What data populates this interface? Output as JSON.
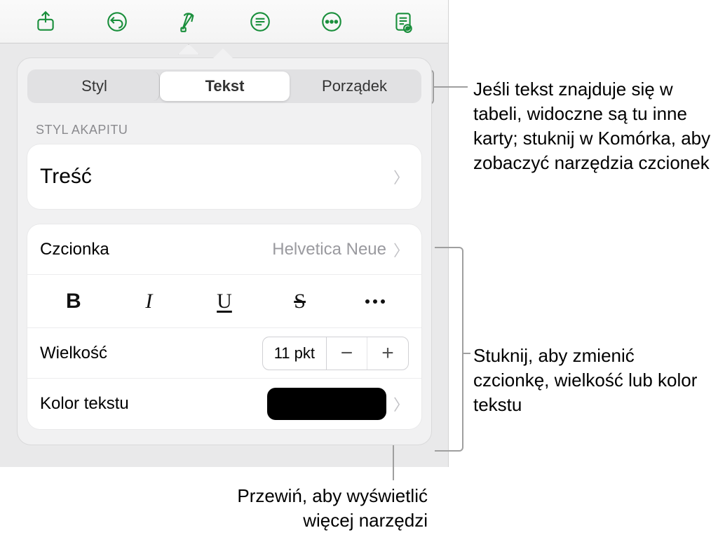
{
  "toolbar": {
    "icons": [
      "share-icon",
      "undo-icon",
      "format-icon",
      "paragraph-icon",
      "more-icon",
      "reader-icon"
    ]
  },
  "segmented": {
    "items": [
      "Styl",
      "Tekst",
      "Porządek"
    ],
    "selected": 1
  },
  "paragraph_section_label": "STYL AKAPITU",
  "paragraph_style": {
    "name": "Treść"
  },
  "font": {
    "label": "Czcionka",
    "value": "Helvetica Neue"
  },
  "format_buttons": {
    "bold": "B",
    "italic": "I",
    "underline": "U",
    "strike": "S"
  },
  "size": {
    "label": "Wielkość",
    "value": "11 pkt"
  },
  "text_color": {
    "label": "Kolor tekstu",
    "swatch": "#000000"
  },
  "callouts": {
    "tabs": "Jeśli tekst znajduje się w tabeli, widoczne są tu inne karty; stuknij w Komórka, aby zobaczyć narzędzia czcionek",
    "font_controls": "Stuknij, aby zmienić czcionkę, wielkość lub kolor tekstu",
    "scroll": "Przewiń, aby wyświetlić więcej narzędzi"
  }
}
